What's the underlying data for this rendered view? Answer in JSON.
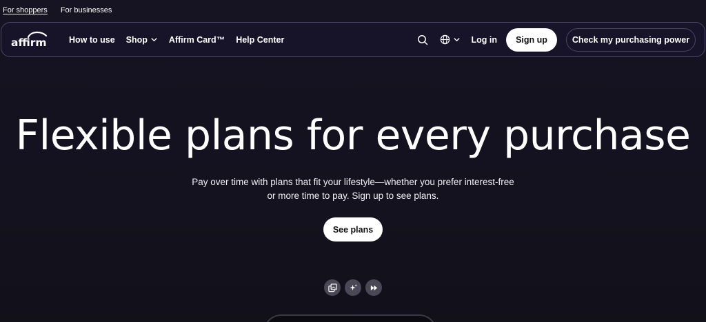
{
  "audience": {
    "shoppers": "For shoppers",
    "businesses": "For businesses"
  },
  "nav": {
    "logo_text": "affirm",
    "links": [
      {
        "label": "How to use"
      },
      {
        "label": "Shop"
      },
      {
        "label": "Affirm Card™"
      },
      {
        "label": "Help Center"
      }
    ],
    "login": "Log in",
    "signup": "Sign up",
    "check_power": "Check my purchasing power"
  },
  "hero": {
    "title": "Flexible plans for every purchase",
    "subtitle": "Pay over time with plans that fit your lifestyle—whether you prefer interest-free or more time to pay. Sign up to see plans.",
    "cta": "See plans"
  },
  "icons": [
    "search-icon",
    "globe-icon",
    "chevron-down-icon",
    "gallery-icon",
    "sparkle-icon",
    "skip-forward-icon"
  ],
  "colors": {
    "background": "#14121f",
    "nav_border": "#4a4766",
    "button_bg": "#ffffff",
    "control_bg": "#4a4857"
  }
}
